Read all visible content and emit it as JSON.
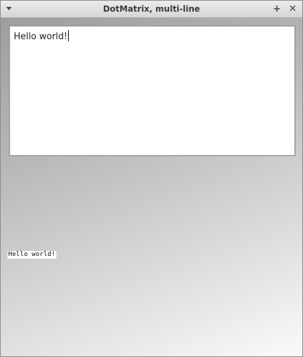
{
  "window": {
    "title": "DotMatrix, multi-line",
    "maximize_glyph": "+",
    "close_glyph": "✕"
  },
  "editor": {
    "text": "Hello world!"
  },
  "dotmatrix_display": {
    "text": "Hello world!"
  }
}
